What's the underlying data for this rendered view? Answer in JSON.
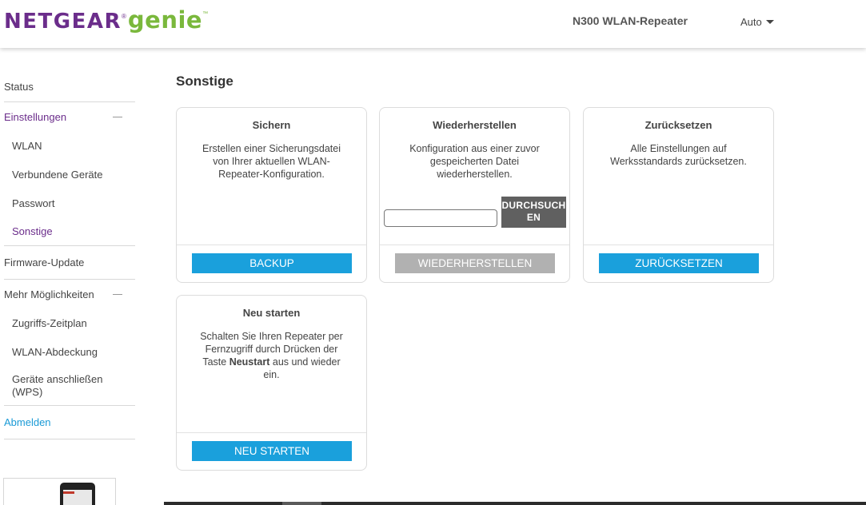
{
  "header": {
    "logo_brand": "NETGEAR",
    "logo_product": "genie",
    "device_name": "N300 WLAN-Repeater",
    "language": "Auto"
  },
  "sidebar": {
    "status": "Status",
    "einstellungen": "Einstellungen",
    "einstellungen_items": [
      "WLAN",
      "Verbundene Geräte",
      "Passwort",
      "Sonstige"
    ],
    "firmware": "Firmware-Update",
    "mehr": "Mehr Möglichkeiten",
    "mehr_items": [
      "Zugriffs-Zeitplan",
      "WLAN-Abdeckung",
      "Geräte anschließen (WPS)"
    ],
    "abmelden": "Abmelden"
  },
  "main": {
    "title": "Sonstige",
    "cards": {
      "sichern": {
        "title": "Sichern",
        "text": "Erstellen einer Sicherungsdatei von Ihrer aktuellen WLAN-Repeater-Konfiguration.",
        "button": "BACKUP"
      },
      "wiederherstellen": {
        "title": "Wiederherstellen",
        "text": "Konfiguration aus einer zuvor gespeicherten Datei wiederherstellen.",
        "file_value": "",
        "browse": "DURCHSUCHEN",
        "button": "WIEDERHERSTELLEN"
      },
      "zuruecksetzen": {
        "title": "Zurücksetzen",
        "text": "Alle Einstellungen auf Werksstandards zurücksetzen.",
        "button": "ZURÜCKSETZEN"
      },
      "neustarten": {
        "title": "Neu starten",
        "text_before": "Schalten Sie Ihren Repeater per Fernzugriff durch Drücken der Taste ",
        "text_bold": "Neustart",
        "text_after": " aus und wieder ein.",
        "button": "NEU STARTEN"
      }
    }
  },
  "colors": {
    "brand_purple": "#6b2d8b",
    "brand_green": "#7ab83c",
    "button_blue": "#1aa0dc",
    "button_disabled": "#b1b1b1",
    "link_blue": "#1a9ad6"
  }
}
